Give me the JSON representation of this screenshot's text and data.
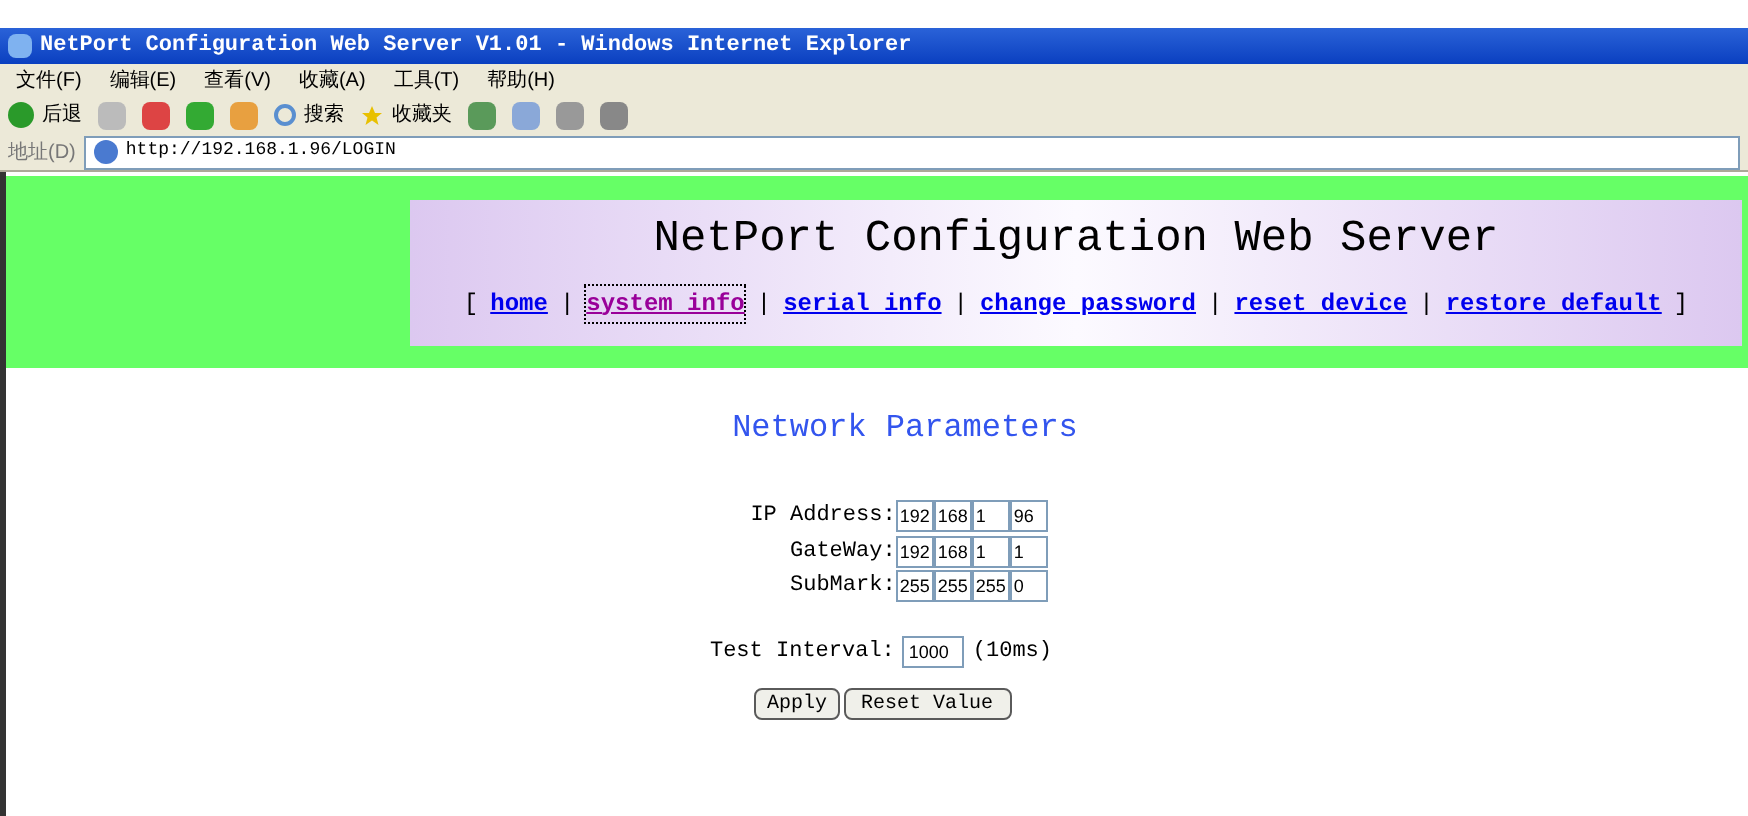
{
  "window": {
    "title": "NetPort Configuration Web Server V1.01 - Windows Internet Explorer"
  },
  "menu": [
    "文件(F)",
    "编辑(E)",
    "查看(V)",
    "收藏(A)",
    "工具(T)",
    "帮助(H)"
  ],
  "toolbar": {
    "back": "后退",
    "search": "搜索",
    "favorites": "收藏夹"
  },
  "address": {
    "label": "地址(D)",
    "value": "http://192.168.1.96/LOGIN"
  },
  "header": {
    "title": "NetPort Configuration Web Server",
    "open_bracket": "[",
    "close_bracket": "]",
    "separator": "|",
    "links": [
      {
        "label": "home",
        "selected": false
      },
      {
        "label": "system info",
        "selected": true
      },
      {
        "label": "serial info",
        "selected": false
      },
      {
        "label": "change password",
        "selected": false
      },
      {
        "label": "reset device",
        "selected": false
      },
      {
        "label": "restore default",
        "selected": false
      }
    ]
  },
  "section_title": "Network Parameters",
  "fields": [
    {
      "label": "IP Address:",
      "octets": [
        "192",
        "168",
        "1",
        "96"
      ]
    },
    {
      "label": "GateWay:",
      "octets": [
        "192",
        "168",
        "1",
        "1"
      ]
    },
    {
      "label": "SubMark:",
      "octets": [
        "255",
        "255",
        "255",
        "0"
      ]
    }
  ],
  "interval": {
    "label": "Test Interval:",
    "value": "1000",
    "unit": "(10ms)"
  },
  "buttons": [
    "Apply",
    "Reset Value"
  ]
}
